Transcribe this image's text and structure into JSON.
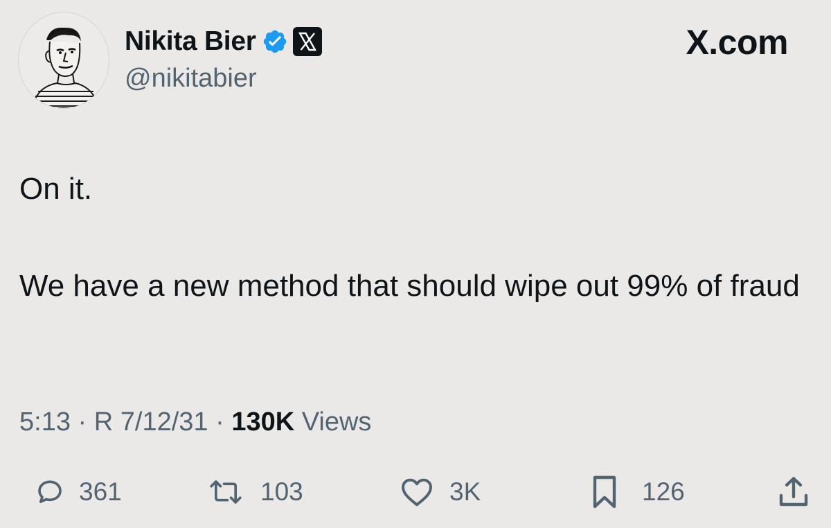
{
  "author": {
    "display_name": "Nikita Bier",
    "handle": "@nikitabier",
    "verified_icon": "verified-badge-icon",
    "affiliate_icon": "x-logo-icon"
  },
  "brand": {
    "label": "X.com"
  },
  "tweet": {
    "paragraphs": [
      "On it.",
      "We have a new method that should wipe out 99% of fraud"
    ],
    "time": "5:13",
    "separator": "·",
    "date": "R 7/12/31",
    "views_count": "130K",
    "views_label": "Views"
  },
  "actions": {
    "replies": "361",
    "reposts": "103",
    "likes": "3K",
    "bookmarks": "126"
  },
  "colors": {
    "background": "#ebe9e8",
    "text_primary": "#0f1419",
    "text_secondary": "#536471",
    "verified_blue": "#1d9bf0"
  }
}
